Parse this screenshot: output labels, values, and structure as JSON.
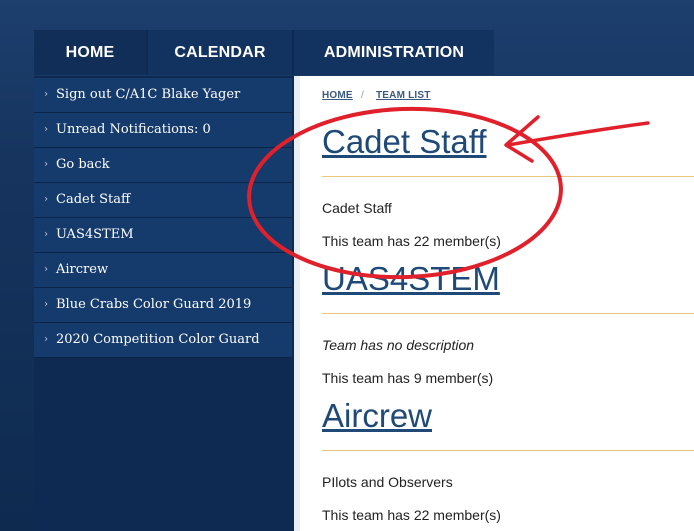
{
  "nav": {
    "home": "HOME",
    "calendar": "CALENDAR",
    "administration": "ADMINISTRATION"
  },
  "sidebar": {
    "items": [
      {
        "label": "Sign out C/A1C Blake Yager"
      },
      {
        "label": "Unread Notifications: 0"
      },
      {
        "label": "Go back"
      },
      {
        "label": "Cadet Staff"
      },
      {
        "label": "UAS4STEM"
      },
      {
        "label": "Aircrew"
      },
      {
        "label": "Blue Crabs Color Guard 2019"
      },
      {
        "label": "2020 Competition Color Guard"
      }
    ]
  },
  "breadcrumb": {
    "home": "HOME",
    "separator": "/",
    "current": "TEAM LIST"
  },
  "teams": [
    {
      "name": "Cadet Staff",
      "description": "Cadet Staff",
      "members": "This team has 22 member(s)"
    },
    {
      "name": "UAS4STEM",
      "description": "Team has no description",
      "members": "This team has 9 member(s)"
    },
    {
      "name": "Aircrew",
      "description": "PIlots and Observers",
      "members": "This team has 22 member(s)"
    }
  ],
  "colors": {
    "background": "#16345e",
    "sidebar_item": "#153a6c",
    "link": "#1f4a78",
    "divider": "#e8c77a",
    "annotation": "#e0202a"
  }
}
